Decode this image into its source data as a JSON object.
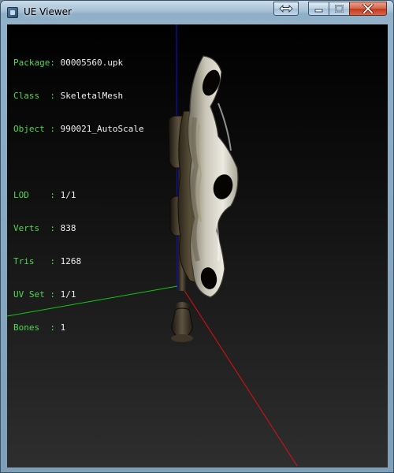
{
  "window": {
    "title": "UE Viewer",
    "icon": "app-icon",
    "controls": {
      "fullscreen_icon": "double-arrow-icon",
      "minimize_icon": "minimize-icon",
      "maximize_icon": "maximize-icon",
      "close_icon": "close-icon"
    }
  },
  "info": {
    "package": {
      "label": "Package",
      "sep": ": ",
      "value": "00005560.upk"
    },
    "class": {
      "label": "Class  ",
      "sep": ": ",
      "value": "SkeletalMesh"
    },
    "object": {
      "label": "Object ",
      "sep": ": ",
      "value": "990021_AutoScale"
    },
    "lod": {
      "label": "LOD    ",
      "sep": ": ",
      "value": "1/1"
    },
    "verts": {
      "label": "Verts  ",
      "sep": ": ",
      "value": "838"
    },
    "tris": {
      "label": "Tris   ",
      "sep": ": ",
      "value": "1268"
    },
    "uvset": {
      "label": "UV Set ",
      "sep": ": ",
      "value": "1/1"
    },
    "bones": {
      "label": "Bones  ",
      "sep": ": ",
      "value": "1"
    }
  },
  "colors": {
    "label_green": "#4fd84f",
    "value_white": "#f0f0f0",
    "axis_x": "#e01010",
    "axis_y": "#10c810",
    "axis_z": "#1010e0"
  }
}
